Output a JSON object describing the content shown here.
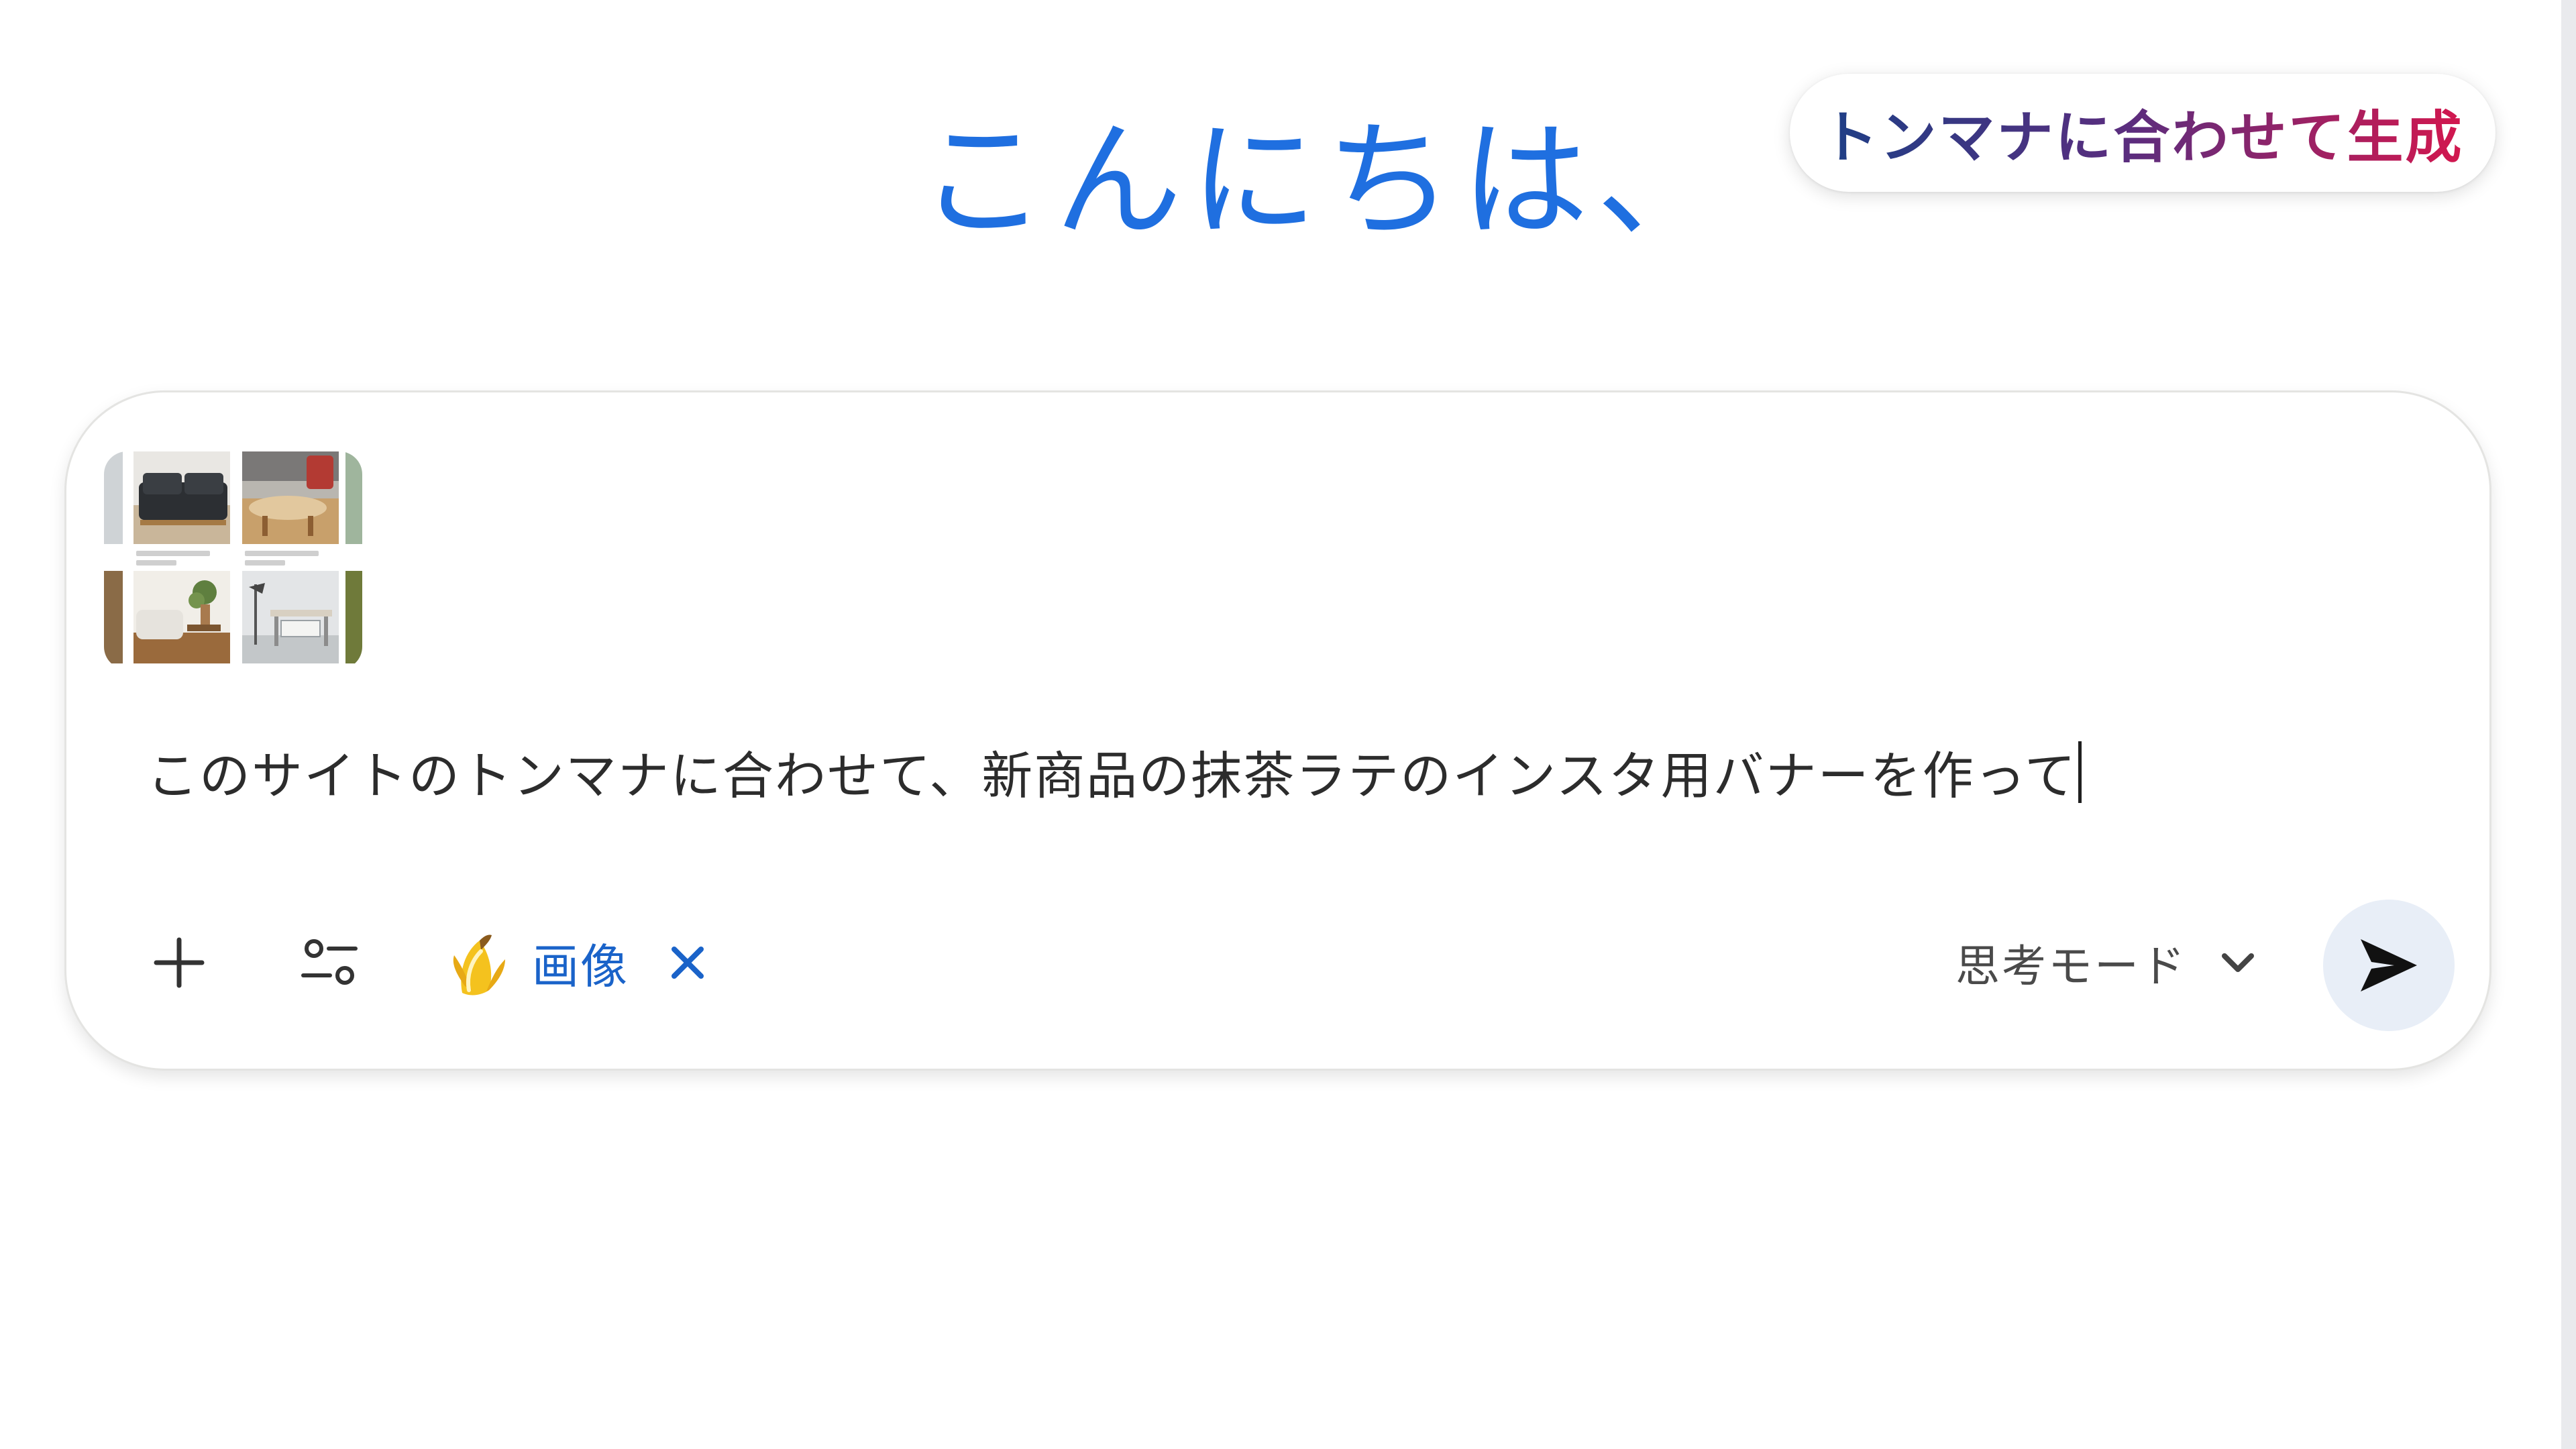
{
  "greeting": {
    "text": "こんにちは、"
  },
  "suggestion_chip": {
    "label": "トンマナに合わせて生成"
  },
  "composer": {
    "attachment": {
      "icon": "image-grid-thumbnail"
    },
    "prompt_text": "このサイトのトンマナに合わせて、新商品の抹茶ラテのインスタ用バナーを作って",
    "toolbar": {
      "add_icon": "plus-icon",
      "tools_icon": "sliders-icon",
      "image_tool": {
        "icon": "banana-icon",
        "label": "画像",
        "remove_icon": "close-icon"
      },
      "mode": {
        "label": "思考モード",
        "icon": "chevron-down-icon"
      },
      "send_icon": "send-icon"
    }
  },
  "colors": {
    "greeting": "#1f6fe0",
    "chip_gradient_start": "#1d3f86",
    "chip_gradient_end": "#d3174e",
    "image_label": "#1a63c9",
    "send_bg": "#e8eef7"
  }
}
